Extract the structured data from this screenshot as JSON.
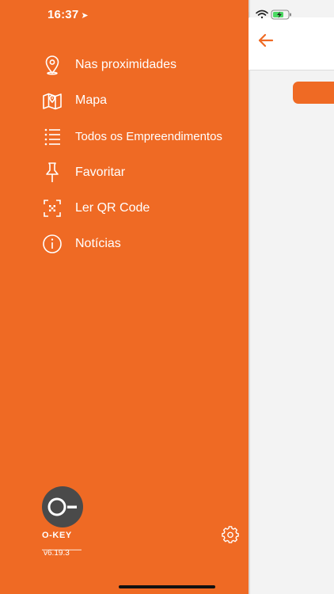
{
  "status_bar": {
    "time": "16:37"
  },
  "menu": {
    "items": [
      {
        "label": "Nas proximidades",
        "icon": "location-pin-icon"
      },
      {
        "label": "Mapa",
        "icon": "map-icon"
      },
      {
        "label": "Todos os Empreendimentos",
        "icon": "list-icon"
      },
      {
        "label": "Favoritar",
        "icon": "pushpin-icon"
      },
      {
        "label": "Ler QR Code",
        "icon": "qr-scan-icon"
      },
      {
        "label": "Notícias",
        "icon": "info-icon"
      }
    ]
  },
  "footer": {
    "logo_text": "O-KEY",
    "version": "v6.19.3"
  },
  "colors": {
    "accent": "#ef6a24",
    "logo_circle": "#4a4a4a"
  }
}
